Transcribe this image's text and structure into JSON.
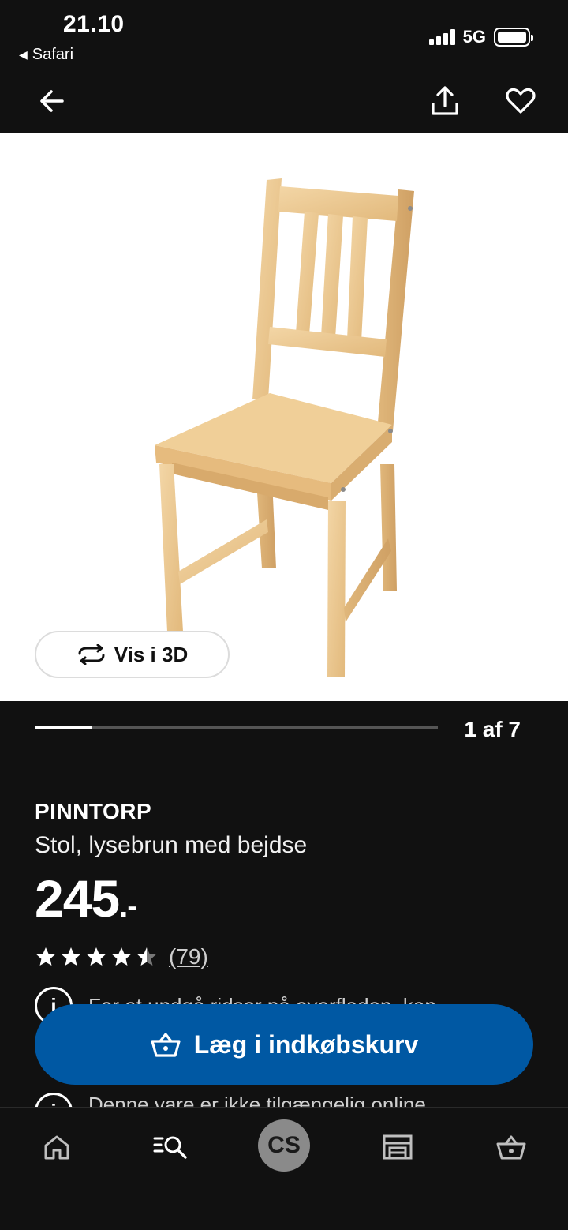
{
  "status_bar": {
    "time": "21.10",
    "back_app": "Safari",
    "network": "5G"
  },
  "nav": {
    "back_icon": "arrow-left-icon",
    "share_icon": "share-icon",
    "favorite_icon": "heart-icon"
  },
  "gallery": {
    "image": "wooden-chair-product-photo",
    "view_3d_label": "Vis i 3D",
    "pager_label": "1 af 7",
    "current_page": 1,
    "total_pages": 7
  },
  "product": {
    "name": "PINNTORP",
    "description": "Stol, lysebrun med bejdse",
    "price": "245",
    "price_suffix": ".-",
    "rating_stars": 4.5,
    "rating_count": "(79)",
    "info_1": "For at undgå ridser på overfladen, kan",
    "info_2": "Denne vare er ikke tilgængelig online"
  },
  "cta": {
    "label": "Læg i indkøbskurv",
    "icon": "basket-icon",
    "color": "#0058a3"
  },
  "tabbar": {
    "home_icon": "home-icon",
    "search_icon": "search-list-icon",
    "avatar_initials": "CS",
    "store_icon": "store-icon",
    "basket_icon": "basket-icon"
  }
}
